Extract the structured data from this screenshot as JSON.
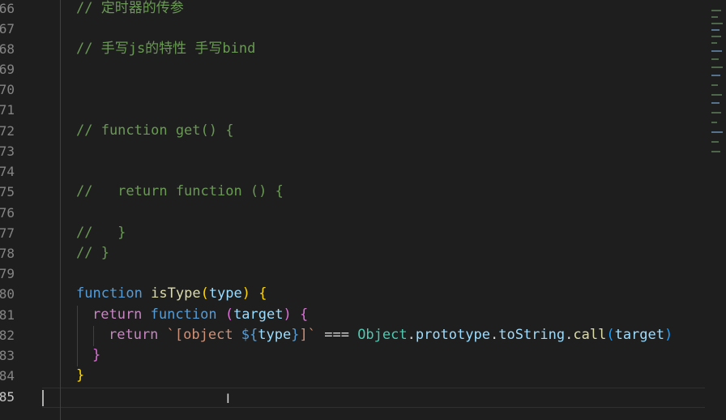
{
  "editor": {
    "gutter": {
      "line_numbers": [
        "66",
        "67",
        "68",
        "69",
        "70",
        "71",
        "72",
        "73",
        "74",
        "75",
        "76",
        "77",
        "78",
        "79",
        "80",
        "81",
        "82",
        "83",
        "84",
        "85"
      ],
      "active_line": "85"
    },
    "lines": {
      "l66": {
        "comment": "// 定时器的传参"
      },
      "l68": {
        "comment": "// 手写js的特性 手写bind"
      },
      "l72": {
        "comment": "// function get() {"
      },
      "l75": {
        "comment": "//   return function () {"
      },
      "l77": {
        "comment": "//   }"
      },
      "l78": {
        "comment": "// }"
      },
      "l80": {
        "kw": "function",
        "name": "isType",
        "lp": "(",
        "param": "type",
        "rp": ")",
        "brace": "{"
      },
      "l81": {
        "kw": "return",
        "kw2": "function",
        "lp": "(",
        "param": "target",
        "rp": ")",
        "brace": "{"
      },
      "l82": {
        "kw": "return",
        "tpl_open": "`[object ",
        "tpl_expr_open": "${",
        "tpl_var": "type",
        "tpl_expr_close": "}",
        "tpl_close": "]`",
        "op": "===",
        "cls": "Object",
        "dot1": ".",
        "prop": "prototype",
        "dot2": ".",
        "method1": "toString",
        "dot3": ".",
        "method2": "call",
        "lp": "(",
        "arg": "target",
        "rp": ")"
      },
      "l83": {
        "brace": "}"
      },
      "l84": {
        "brace": "}"
      }
    },
    "mouse_cursor_glyph": "I"
  },
  "colors": {
    "background": "#1e1e1e",
    "comment": "#6a9955",
    "keyword": "#569cd6",
    "control_keyword": "#c586c0",
    "function_name": "#dcdcaa",
    "parameter": "#9cdcfe",
    "string": "#ce9178",
    "class": "#4ec9b0",
    "bracket_level1": "#ffd700",
    "bracket_level2": "#da70d6",
    "bracket_level3": "#179fff"
  }
}
